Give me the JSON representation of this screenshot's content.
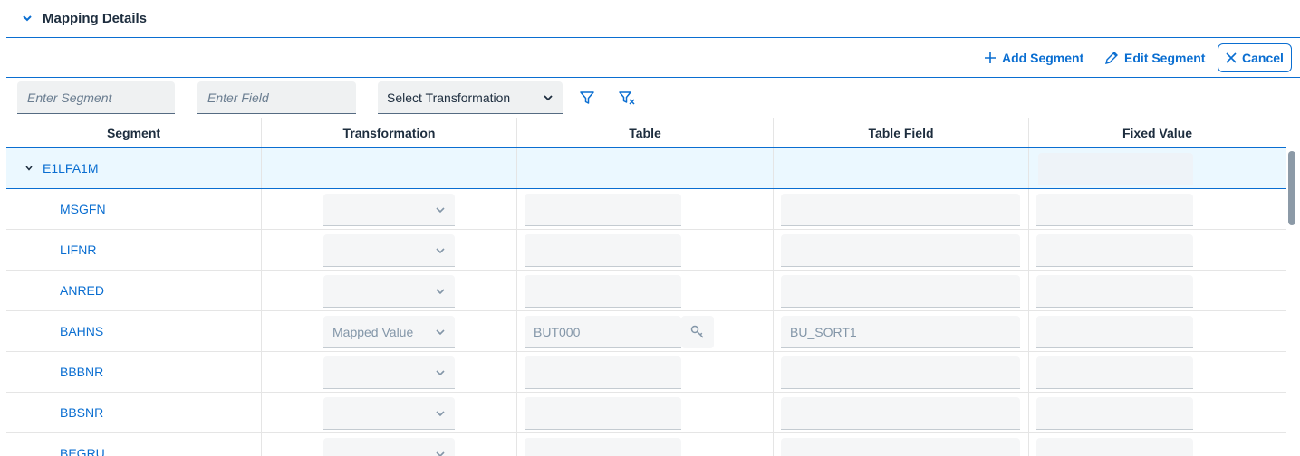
{
  "panel": {
    "title": "Mapping Details"
  },
  "toolbar": {
    "add_label": "Add Segment",
    "edit_label": "Edit Segment",
    "cancel_label": "Cancel"
  },
  "filters": {
    "segment_placeholder": "Enter Segment",
    "field_placeholder": "Enter Field",
    "transformation_value": "Select Transformation"
  },
  "table": {
    "columns": [
      "Segment",
      "Transformation",
      "Table",
      "Table Field",
      "Fixed Value"
    ],
    "group": {
      "label": "E1LFA1M"
    },
    "rows": [
      {
        "segment": "MSGFN",
        "transformation": "",
        "table": "",
        "table_field": "",
        "fixed_value": ""
      },
      {
        "segment": "LIFNR",
        "transformation": "",
        "table": "",
        "table_field": "",
        "fixed_value": ""
      },
      {
        "segment": "ANRED",
        "transformation": "",
        "table": "",
        "table_field": "",
        "fixed_value": ""
      },
      {
        "segment": "BAHNS",
        "transformation": "Mapped Value",
        "table": "BUT000",
        "table_field": "BU_SORT1",
        "fixed_value": ""
      },
      {
        "segment": "BBBNR",
        "transformation": "",
        "table": "",
        "table_field": "",
        "fixed_value": ""
      },
      {
        "segment": "BBSNR",
        "transformation": "",
        "table": "",
        "table_field": "",
        "fixed_value": ""
      },
      {
        "segment": "BEGRU",
        "transformation": "",
        "table": "",
        "table_field": "",
        "fixed_value": ""
      }
    ]
  },
  "colors": {
    "accent": "#0a6ed1",
    "group_bg": "#ebf8ff",
    "field_bg": "#f5f6f7"
  },
  "icons": [
    "chevron-down-icon",
    "add-icon",
    "edit-icon",
    "close-icon",
    "filter-icon",
    "clear-filter-icon",
    "value-help-icon"
  ]
}
